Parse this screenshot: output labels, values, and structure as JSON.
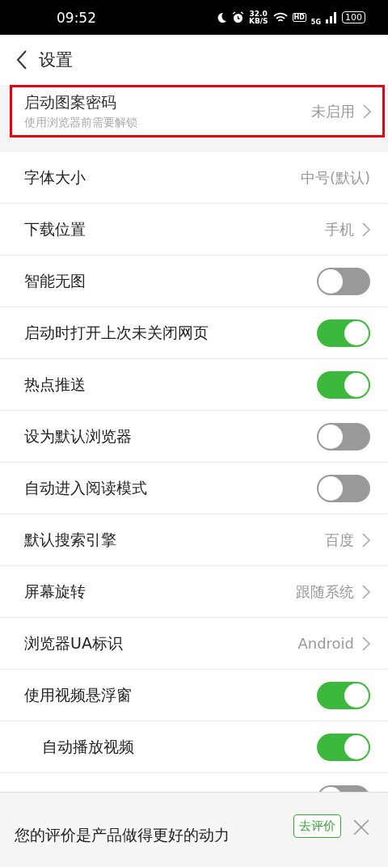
{
  "status_bar": {
    "time": "09:52",
    "speed": "32.0",
    "speed_unit": "KB/S",
    "hd": "HD",
    "network": "5G",
    "battery": "100"
  },
  "header": {
    "title": "设置"
  },
  "lock_item": {
    "label": "启动图案密码",
    "subtitle": "使用浏览器前需要解锁",
    "value": "未启用",
    "highlighted": true
  },
  "settings": [
    {
      "kind": "value",
      "label": "字体大小",
      "value": "中号(默认)",
      "arrow": false
    },
    {
      "kind": "value",
      "label": "下载位置",
      "value": "手机",
      "arrow": true
    },
    {
      "kind": "toggle",
      "label": "智能无图",
      "on": false
    },
    {
      "kind": "toggle",
      "label": "启动时打开上次未关闭网页",
      "on": true
    },
    {
      "kind": "toggle",
      "label": "热点推送",
      "on": true
    },
    {
      "kind": "toggle",
      "label": "设为默认浏览器",
      "on": false
    },
    {
      "kind": "toggle",
      "label": "自动进入阅读模式",
      "on": false
    },
    {
      "kind": "value",
      "label": "默认搜索引擎",
      "value": "百度",
      "arrow": true
    },
    {
      "kind": "value",
      "label": "屏幕旋转",
      "value": "跟随系统",
      "arrow": true
    },
    {
      "kind": "value",
      "label": "浏览器UA标识",
      "value": "Android",
      "arrow": true
    },
    {
      "kind": "toggle",
      "label": "使用视频悬浮窗",
      "on": true,
      "children": [
        {
          "kind": "toggle",
          "label": "自动播放视频",
          "on": true
        }
      ]
    },
    {
      "kind": "toggle",
      "on": false
    }
  ],
  "rating_bar": {
    "message": "您的评价是产品做得更好的动力",
    "button": "去评价"
  }
}
